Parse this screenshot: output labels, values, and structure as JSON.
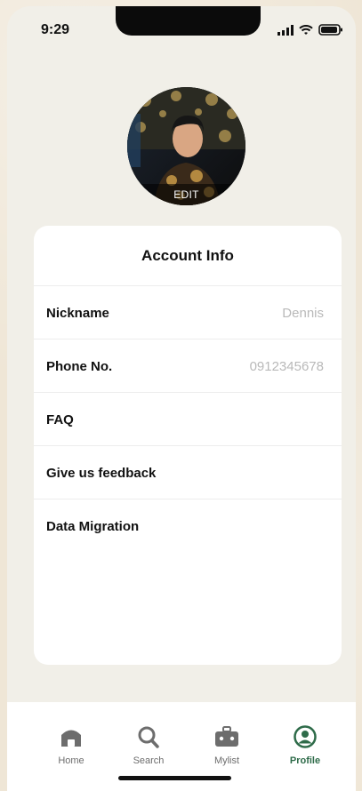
{
  "status": {
    "time": "9:29"
  },
  "profile": {
    "edit_label": "EDIT"
  },
  "account": {
    "title": "Account Info",
    "rows": [
      {
        "label": "Nickname",
        "value": "Dennis"
      },
      {
        "label": "Phone No.",
        "value": "0912345678"
      },
      {
        "label": "FAQ",
        "value": ""
      },
      {
        "label": "Give us feedback",
        "value": ""
      },
      {
        "label": "Data Migration",
        "value": ""
      }
    ]
  },
  "tabbar": {
    "items": [
      {
        "label": "Home",
        "icon": "home-icon"
      },
      {
        "label": "Search",
        "icon": "search-icon"
      },
      {
        "label": "Mylist",
        "icon": "briefcase-icon"
      },
      {
        "label": "Profile",
        "icon": "profile-icon"
      }
    ],
    "active": "Profile",
    "active_color": "#2e6b49"
  }
}
